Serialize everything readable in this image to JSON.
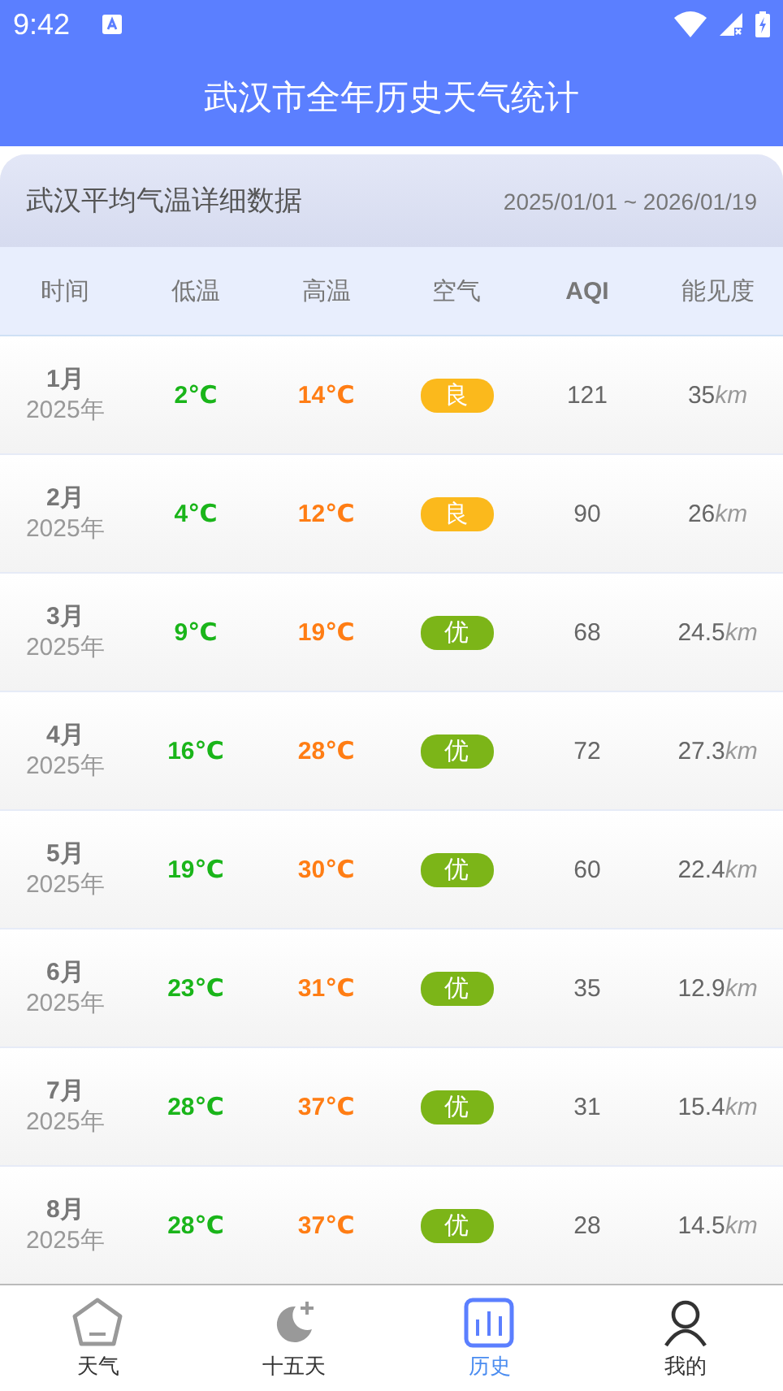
{
  "status_bar": {
    "time": "9:42"
  },
  "header": {
    "title": "武汉市全年历史天气统计"
  },
  "card": {
    "title": "武汉平均气温详细数据",
    "range": "2025/01/01 ~ 2026/01/19"
  },
  "columns": [
    "时间",
    "低温",
    "高温",
    "空气",
    "AQI",
    "能见度"
  ],
  "rows": [
    {
      "month": "1月",
      "year": "2025年",
      "low": "2℃",
      "high": "14℃",
      "air": "良",
      "color": "#fbb91c",
      "aqi": "121",
      "visibility": "35",
      "unit": "km"
    },
    {
      "month": "2月",
      "year": "2025年",
      "low": "4℃",
      "high": "12℃",
      "air": "良",
      "color": "#fbb91c",
      "aqi": "90",
      "visibility": "26",
      "unit": "km"
    },
    {
      "month": "3月",
      "year": "2025年",
      "low": "9℃",
      "high": "19℃",
      "air": "优",
      "color": "#7cb518",
      "aqi": "68",
      "visibility": "24.5",
      "unit": "km"
    },
    {
      "month": "4月",
      "year": "2025年",
      "low": "16℃",
      "high": "28℃",
      "air": "优",
      "color": "#7cb518",
      "aqi": "72",
      "visibility": "27.3",
      "unit": "km"
    },
    {
      "month": "5月",
      "year": "2025年",
      "low": "19℃",
      "high": "30℃",
      "air": "优",
      "color": "#7cb518",
      "aqi": "60",
      "visibility": "22.4",
      "unit": "km"
    },
    {
      "month": "6月",
      "year": "2025年",
      "low": "23℃",
      "high": "31℃",
      "air": "优",
      "color": "#7cb518",
      "aqi": "35",
      "visibility": "12.9",
      "unit": "km"
    },
    {
      "month": "7月",
      "year": "2025年",
      "low": "28℃",
      "high": "37℃",
      "air": "优",
      "color": "#7cb518",
      "aqi": "31",
      "visibility": "15.4",
      "unit": "km"
    },
    {
      "month": "8月",
      "year": "2025年",
      "low": "28℃",
      "high": "37℃",
      "air": "优",
      "color": "#7cb518",
      "aqi": "28",
      "visibility": "14.5",
      "unit": "km"
    }
  ],
  "nav": [
    {
      "kind": "home",
      "label": "天气",
      "selected": false
    },
    {
      "kind": "moon",
      "label": "十五天",
      "selected": false
    },
    {
      "kind": "chart",
      "label": "历史",
      "selected": true
    },
    {
      "kind": "user",
      "label": "我的",
      "selected": false
    }
  ]
}
